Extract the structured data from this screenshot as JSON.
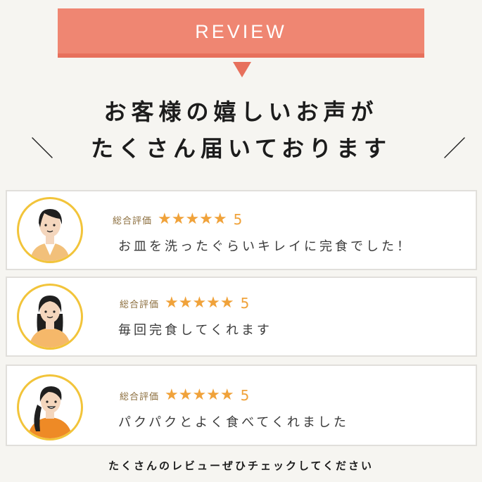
{
  "header": {
    "ribbon_label": "REVIEW",
    "headline_line1": "お客様の嬉しいお声が",
    "headline_line2": "たくさん届いております",
    "left_slash": "＼",
    "right_slash": "／"
  },
  "colors": {
    "ribbon": "#ef8672",
    "star": "#f0a23a",
    "avatar_border": "#f2c43a"
  },
  "reviews": [
    {
      "rating_label": "総合評価",
      "stars": "★★★★★",
      "rating": "5",
      "comment": "お皿を洗ったぐらいキレイに完食でした！",
      "avatar_icon": "woman-short-hair-avatar-icon"
    },
    {
      "rating_label": "総合評価",
      "stars": "★★★★★",
      "rating": "5",
      "comment": "毎回完食してくれます",
      "avatar_icon": "woman-long-hair-avatar-icon"
    },
    {
      "rating_label": "総合評価",
      "stars": "★★★★★",
      "rating": "5",
      "comment": "パクパクとよく食べてくれました",
      "avatar_icon": "woman-ponytail-avatar-icon"
    }
  ],
  "footer": {
    "text": "たくさんのレビューぜひチェックしてください"
  }
}
